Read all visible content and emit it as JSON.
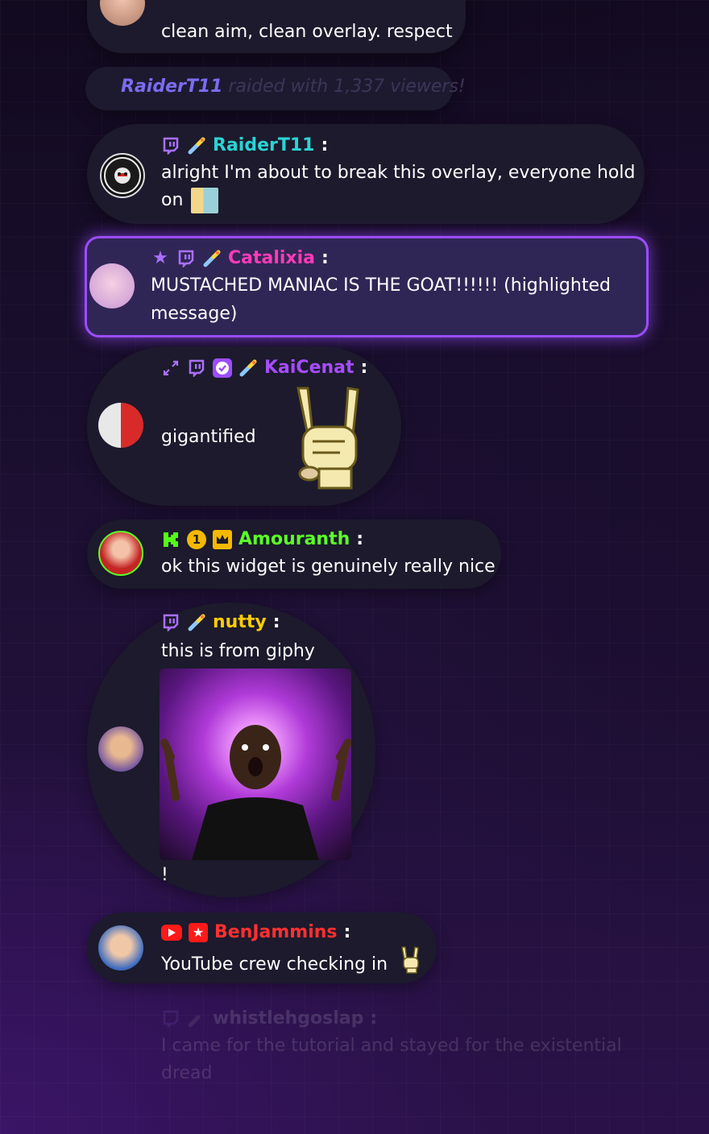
{
  "messages": {
    "m0": {
      "text": "clean aim, clean overlay. respect"
    },
    "raid": {
      "user": "RaiderT11",
      "text": "raided with 1,337 viewers!"
    },
    "m1": {
      "user": "RaiderT11",
      "text": "alright I'm about to break this overlay, everyone hold",
      "text2": "on",
      "color": "#2ad4d4"
    },
    "m2": {
      "user": "Catalixia",
      "text": "MUSTACHED MANIAC IS THE GOAT!!!!!! (highlighted",
      "text2": "message)",
      "color": "#ff3bb7"
    },
    "m3": {
      "user": "KaiCenat",
      "text": "gigantified",
      "color": "#a64dff"
    },
    "m4": {
      "user": "Amouranth",
      "text": "ok this widget is genuinely really nice",
      "color": "#5bff28",
      "badge_number": "1"
    },
    "m5": {
      "user": "nutty",
      "text": "this is from giphy",
      "after_text": "!",
      "color": "#ffcc00"
    },
    "m6": {
      "user": "BenJammins",
      "text": "YouTube crew checking in",
      "color": "#ff3030"
    },
    "m7": {
      "user": "whistlehgoslap",
      "text": "I came for the tutorial and stayed for the existential",
      "text2": "dread"
    }
  },
  "colon": ":",
  "icons": {
    "twitch": "twitch-icon",
    "rocket": "rocket-icon",
    "star": "star-icon",
    "expand": "expand-icon",
    "verified": "verified-icon",
    "crown": "crown-icon",
    "youtube": "youtube-icon",
    "rock_hand": "rock-hand-icon"
  }
}
